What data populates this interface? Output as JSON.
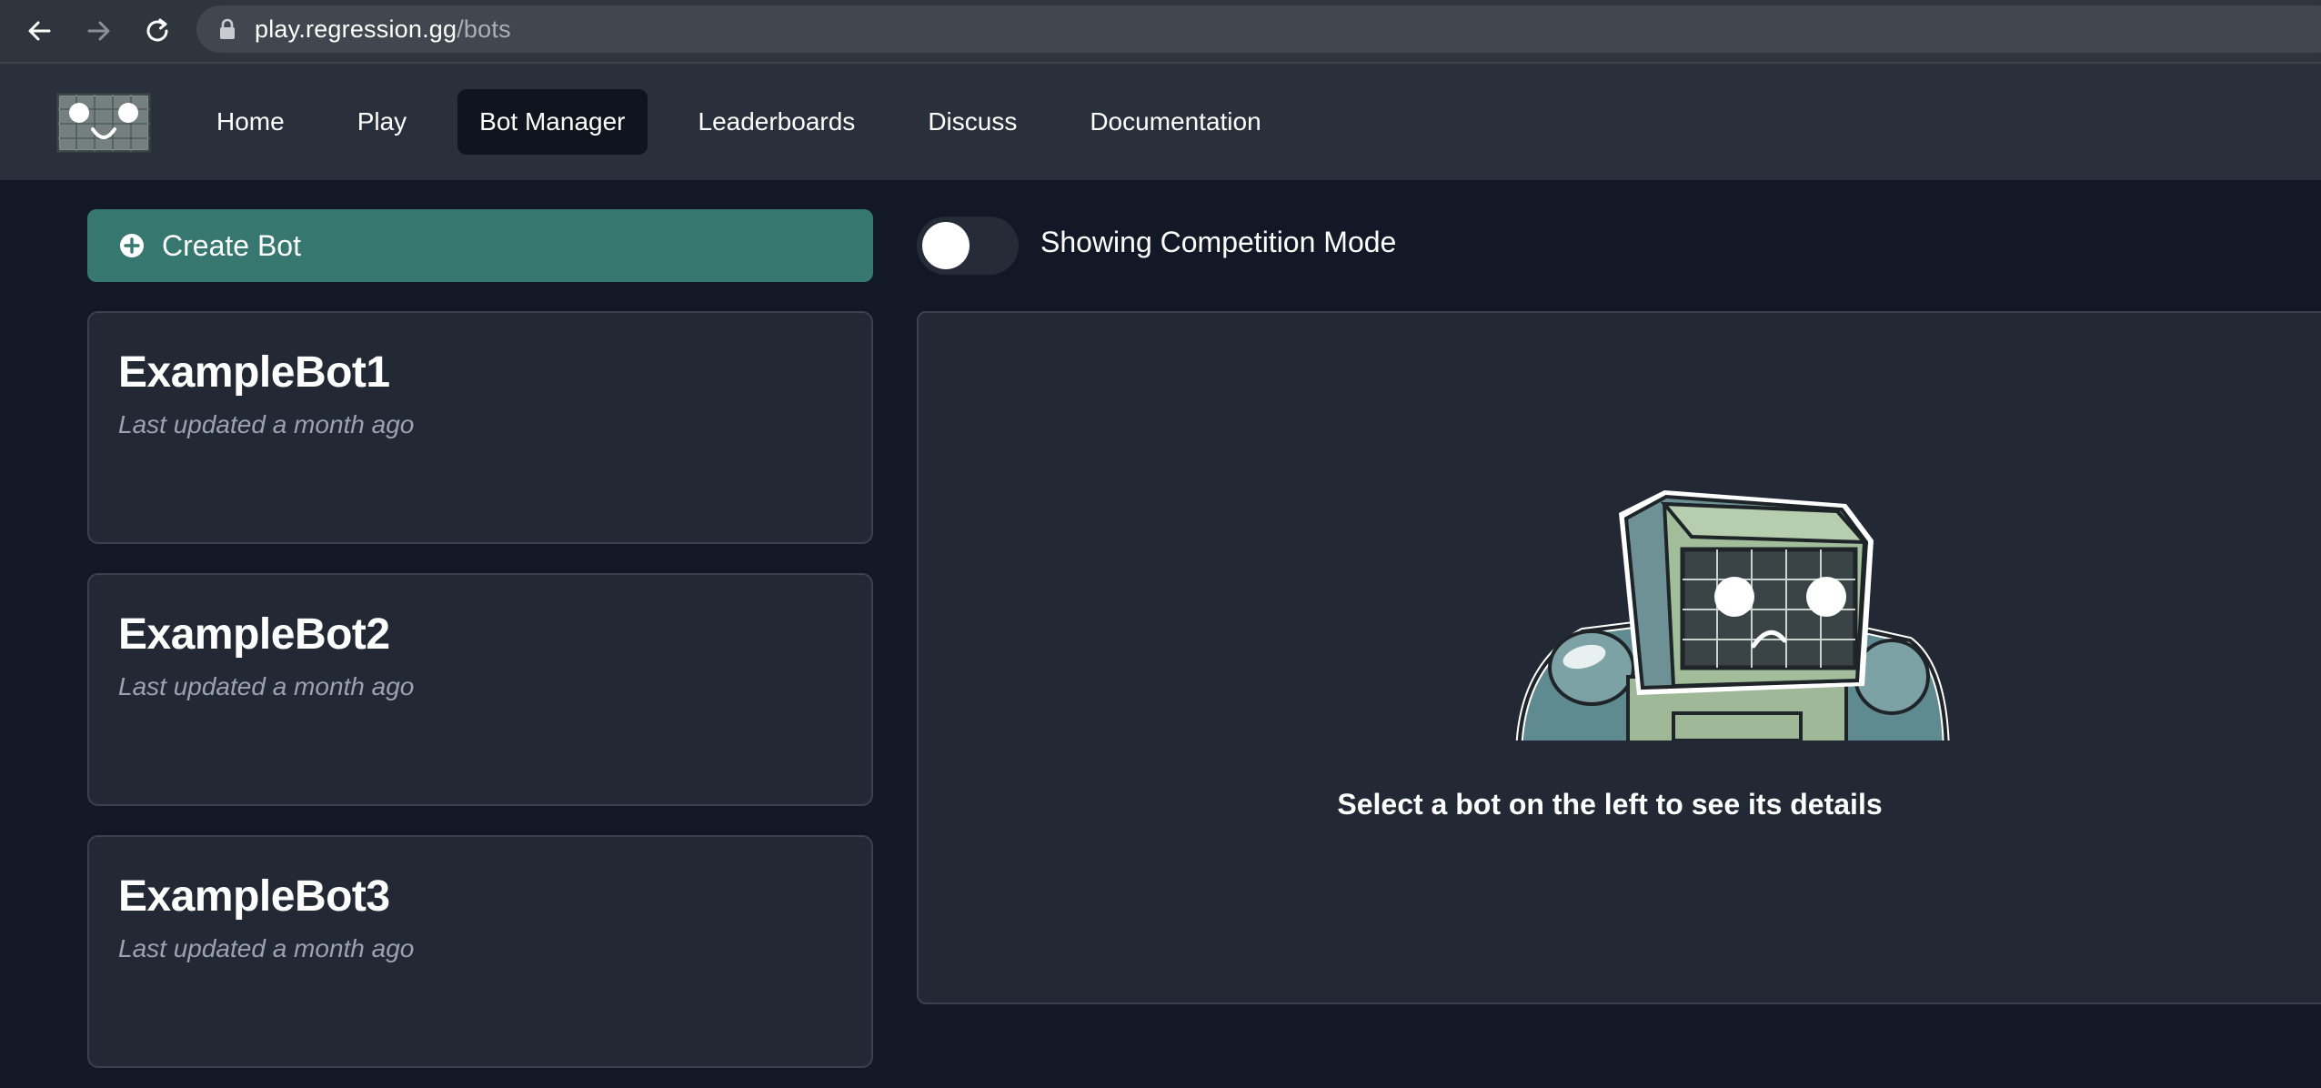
{
  "browser": {
    "url_domain": "play.regression.gg",
    "url_path": "/bots",
    "icons": [
      "back-arrow-icon",
      "forward-arrow-icon",
      "reload-icon",
      "lock-icon"
    ]
  },
  "header": {
    "logo_icon": "smiley-grid-logo",
    "nav": [
      {
        "label": "Home",
        "active": false
      },
      {
        "label": "Play",
        "active": false
      },
      {
        "label": "Bot Manager",
        "active": true
      },
      {
        "label": "Leaderboards",
        "active": false
      },
      {
        "label": "Discuss",
        "active": false
      },
      {
        "label": "Documentation",
        "active": false
      }
    ]
  },
  "sidebar": {
    "create_button_label": "Create Bot",
    "create_button_icon": "plus-circle-icon",
    "bots": [
      {
        "name": "ExampleBot1",
        "updated": "Last updated a month ago"
      },
      {
        "name": "ExampleBot2",
        "updated": "Last updated a month ago"
      },
      {
        "name": "ExampleBot3",
        "updated": "Last updated a month ago"
      }
    ]
  },
  "main": {
    "toggle_label": "Showing Competition Mode",
    "toggle_on": false,
    "empty_state_text": "Select a bot on the left to see its details",
    "empty_state_icon": "robot-illustration"
  },
  "colors": {
    "page_bg": "#121826",
    "header_bg": "#2a303b",
    "card_bg": "#222834",
    "accent": "#36776f",
    "muted_text": "#9aa3b0"
  }
}
